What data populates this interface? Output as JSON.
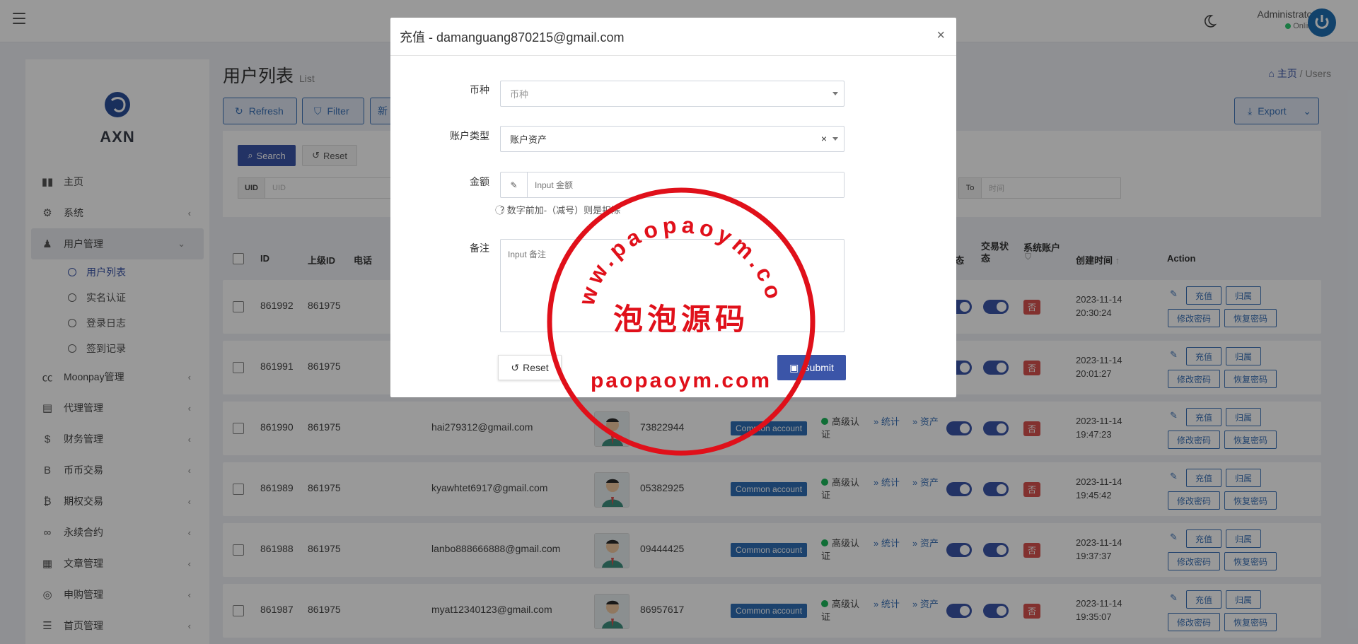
{
  "topbar": {
    "user_name": "Administrator",
    "user_status": "Online"
  },
  "sidebar": {
    "brand": "AXN",
    "items": [
      {
        "label": "主页",
        "icon": "bar-chart-icon",
        "chevron": ""
      },
      {
        "label": "系统",
        "icon": "gear-icon",
        "chevron": "‹"
      },
      {
        "label": "用户管理",
        "icon": "users-icon",
        "chevron": "⌄"
      },
      {
        "label": "Moonpay管理",
        "icon": "cc-icon",
        "chevron": "‹"
      },
      {
        "label": "代理管理",
        "icon": "id-card-icon",
        "chevron": "‹"
      },
      {
        "label": "财务管理",
        "icon": "dollar-icon",
        "chevron": "‹"
      },
      {
        "label": "币币交易",
        "icon": "bitcoin-b-icon",
        "chevron": "‹"
      },
      {
        "label": "期权交易",
        "icon": "bitcoin-icon",
        "chevron": "‹"
      },
      {
        "label": "永续合约",
        "icon": "link-icon",
        "chevron": "‹"
      },
      {
        "label": "文章管理",
        "icon": "newspaper-icon",
        "chevron": "‹"
      },
      {
        "label": "申购管理",
        "icon": "lifebuoy-icon",
        "chevron": "‹"
      },
      {
        "label": "首页管理",
        "icon": "list-icon",
        "chevron": "‹"
      }
    ],
    "submenu": [
      "用户列表",
      "实名认证",
      "登录日志",
      "签到记录"
    ]
  },
  "header": {
    "title": "用户列表",
    "subtitle": "List",
    "crumb_home": "主页",
    "crumb_sep": "/",
    "crumb_current": "Users",
    "refresh": "Refresh",
    "filter": "Filter",
    "new_partial": "新",
    "export": "Export"
  },
  "search": {
    "search_btn": "Search",
    "reset_btn": "Reset",
    "uid_label": "UID",
    "uid_placeholder": "UID",
    "to_label": "To",
    "time_placeholder": "时间"
  },
  "table": {
    "headers": {
      "id": "ID",
      "parent": "上级ID",
      "phone": "电话",
      "state_partial": "态",
      "trade_status": "交易状态",
      "system_account": "系统账户",
      "created": "创建时间",
      "action": "Action"
    },
    "rows": [
      {
        "id": "861992",
        "parent": "861975",
        "email": "",
        "phone_no": "",
        "created_date": "2023-11-14",
        "created_time": "20:30:24"
      },
      {
        "id": "861991",
        "parent": "861975",
        "email": "",
        "phone_no": "",
        "created_date": "2023-11-14",
        "created_time": "20:01:27"
      },
      {
        "id": "861990",
        "parent": "861975",
        "email": "hai279312@gmail.com",
        "phone_no": "73822944",
        "created_date": "2023-11-14",
        "created_time": "19:47:23"
      },
      {
        "id": "861989",
        "parent": "861975",
        "email": "kyawhtet6917@gmail.com",
        "phone_no": "05382925",
        "created_date": "2023-11-14",
        "created_time": "19:45:42"
      },
      {
        "id": "861988",
        "parent": "861975",
        "email": "lanbo888666888@gmail.com",
        "phone_no": "09444425",
        "created_date": "2023-11-14",
        "created_time": "19:37:37"
      },
      {
        "id": "861987",
        "parent": "861975",
        "email": "myat12340123@gmail.com",
        "phone_no": "86957617",
        "created_date": "2023-11-14",
        "created_time": "19:35:07"
      }
    ],
    "account_badge": "Common account",
    "auth_label": "高级认证",
    "stats_link": "» 统计",
    "assets_link": "» 资产",
    "no_badge": "否",
    "btn_recharge": "充值",
    "btn_belong": "归属",
    "btn_change_pwd": "修改密码",
    "btn_restore_pwd": "恢复密码"
  },
  "modal": {
    "title": "充值 - damanguang870215@gmail.com",
    "close": "×",
    "currency_label": "币种",
    "currency_placeholder": "币种",
    "account_type_label": "账户类型",
    "account_type_value": "账户资产",
    "account_type_clear": "×",
    "amount_label": "金额",
    "amount_placeholder": "Input 金额",
    "hint": "数字前加-（减号）则是扣除",
    "remark_label": "备注",
    "remark_placeholder": "Input 备注",
    "reset": "Reset",
    "submit": "Submit"
  },
  "watermark": {
    "ring_text": "www.paopaoym.com",
    "center_text": "泡泡源码",
    "bottom_text": "paopaoym.com"
  }
}
